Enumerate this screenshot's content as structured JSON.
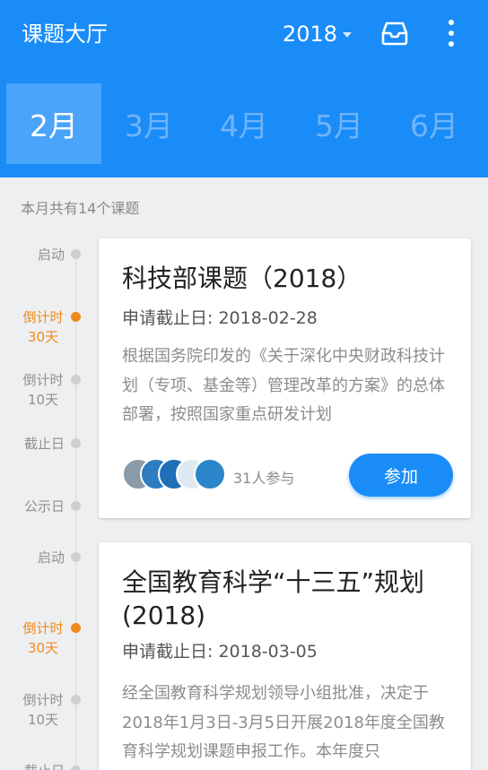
{
  "header": {
    "title": "课题大厅",
    "year": "2018",
    "inbox_icon": "inbox-icon",
    "more_icon": "more-vertical-icon",
    "background_color": "#1a8cf8"
  },
  "months": [
    "2月",
    "3月",
    "4月",
    "5月",
    "6月"
  ],
  "selected_month": "2月",
  "summary": "本月共有14个课题",
  "timeline_stages": [
    {
      "label": "启动",
      "accent": false
    },
    {
      "label": "倒计时\n30天",
      "accent": true
    },
    {
      "label": "倒计时\n10天",
      "accent": false
    },
    {
      "label": "截止日",
      "accent": false
    },
    {
      "label": "公示日",
      "accent": false
    }
  ],
  "projects": [
    {
      "title": "科技部课题（2018）",
      "deadline": "申请截止日: 2018-02-28",
      "description": "根据国务院印发的《关于深化中央财政科技计划（专项、基金等）管理改革的方案》的总体部署，按照国家重点研发计划",
      "participants": "31人参与",
      "join_label": "参加"
    },
    {
      "title": "全国教育科学“十三五”规划(2018)",
      "deadline": "申请截止日: 2018-03-05",
      "description": "经全国教育科学规划领导小组批准，决定于2018年1月3日-3月5日开展2018年度全国教育科学规划课题申报工作。本年度只"
    }
  ],
  "accent_color": "#f08a1c"
}
